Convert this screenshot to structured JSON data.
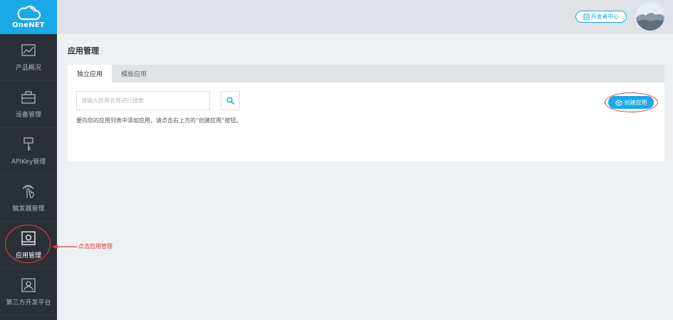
{
  "sidebar": {
    "logo_text": "OneNET",
    "items": [
      {
        "label": "产品概况",
        "icon": "chart-line-icon",
        "active": false
      },
      {
        "label": "设备管理",
        "icon": "toolbox-icon",
        "active": false
      },
      {
        "label": "APIKey管理",
        "icon": "key-icon",
        "active": false
      },
      {
        "label": "触发器管理",
        "icon": "hand-touch-icon",
        "active": false
      },
      {
        "label": "应用管理",
        "icon": "app-icon",
        "active": true
      },
      {
        "label": "第三方开发平台",
        "icon": "picture-icon",
        "active": false
      }
    ]
  },
  "header": {
    "dev_center_label": "开发者中心"
  },
  "main": {
    "title": "应用管理",
    "tabs": [
      {
        "label": "独立应用",
        "active": true
      },
      {
        "label": "模板应用",
        "active": false
      }
    ],
    "search": {
      "placeholder": "请输入应用名称进行搜索",
      "value": ""
    },
    "create_label": "创建应用",
    "hint": "要向您的应用列表中添加应用，请点击右上方的“创建应用”按钮。"
  },
  "annotation": {
    "text": "点击应用管理"
  },
  "colors": {
    "brand": "#1aa8e6",
    "sidebar_bg": "#2b3036",
    "annotation": "#e23a3a"
  }
}
